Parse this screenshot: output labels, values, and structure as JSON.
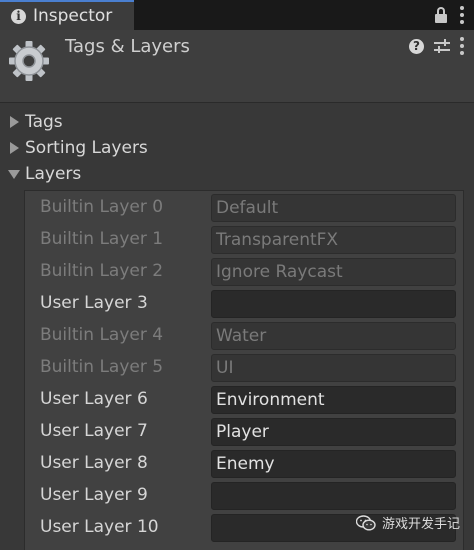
{
  "tab": {
    "title": "Inspector"
  },
  "header": {
    "title": "Tags & Layers"
  },
  "foldouts": {
    "tags": "Tags",
    "sorting_layers": "Sorting Layers",
    "layers": "Layers"
  },
  "layers": [
    {
      "label": "Builtin Layer 0",
      "value": "Default",
      "builtin": true
    },
    {
      "label": "Builtin Layer 1",
      "value": "TransparentFX",
      "builtin": true
    },
    {
      "label": "Builtin Layer 2",
      "value": "Ignore Raycast",
      "builtin": true
    },
    {
      "label": "User Layer 3",
      "value": "",
      "builtin": false
    },
    {
      "label": "Builtin Layer 4",
      "value": "Water",
      "builtin": true
    },
    {
      "label": "Builtin Layer 5",
      "value": "UI",
      "builtin": true
    },
    {
      "label": "User Layer 6",
      "value": "Environment",
      "builtin": false
    },
    {
      "label": "User Layer 7",
      "value": "Player",
      "builtin": false
    },
    {
      "label": "User Layer 8",
      "value": "Enemy",
      "builtin": false
    },
    {
      "label": "User Layer 9",
      "value": "",
      "builtin": false
    },
    {
      "label": "User Layer 10",
      "value": "",
      "builtin": false
    }
  ],
  "watermark": {
    "text": "游戏开发手记"
  },
  "icons": {
    "tab": "info-icon",
    "lock": "lock-icon",
    "menu": "kebab-menu-icon",
    "component": "gear-icon",
    "help": "help-icon",
    "presets": "presets-icon",
    "watermark": "wechat-icon"
  },
  "colors": {
    "accent": "#4a7fd0",
    "background": "#383838",
    "panel": "#414141"
  }
}
